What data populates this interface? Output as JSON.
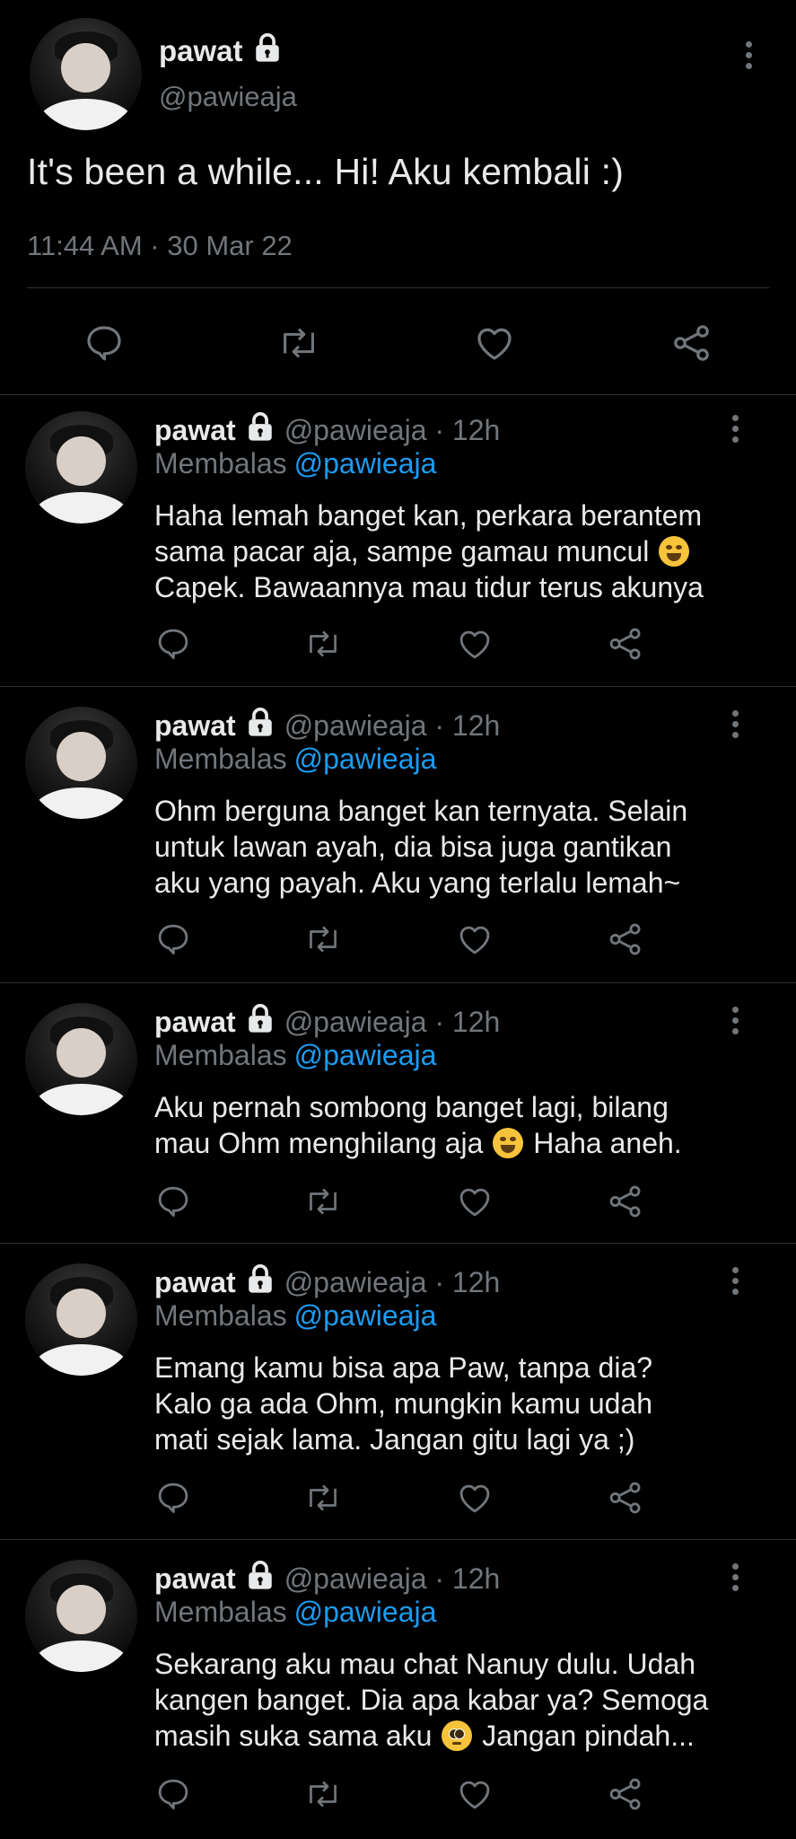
{
  "main_tweet": {
    "name": "pawat",
    "handle": "@pawieaja",
    "text": "It's been a while... Hi! Aku kembali :)",
    "timestamp": "11:44 AM · 30 Mar 22"
  },
  "replies": [
    {
      "name": "pawat",
      "meta": "@pawieaja · 12h",
      "replying_label": "Membalas",
      "replying_to": "@pawieaja",
      "lines": [
        "Haha lemah banget kan, perkara berantem",
        "sama pacar aja, sampe gamau muncul",
        "Capek. Bawaannya mau tidur terus akunya"
      ]
    },
    {
      "name": "pawat",
      "meta": "@pawieaja · 12h",
      "replying_label": "Membalas",
      "replying_to": "@pawieaja",
      "lines": [
        "Ohm berguna banget kan ternyata. Selain",
        "untuk lawan ayah, dia bisa juga gantikan",
        "aku yang payah. Aku yang terlalu lemah~"
      ]
    },
    {
      "name": "pawat",
      "meta": "@pawieaja · 12h",
      "replying_label": "Membalas",
      "replying_to": "@pawieaja",
      "lines": [
        "Aku pernah sombong banget lagi, bilang",
        "mau Ohm menghilang aja",
        "Haha aneh."
      ]
    },
    {
      "name": "pawat",
      "meta": "@pawieaja · 12h",
      "replying_label": "Membalas",
      "replying_to": "@pawieaja",
      "lines": [
        "Emang kamu bisa apa Paw, tanpa dia?",
        "Kalo ga ada Ohm, mungkin kamu udah",
        "mati sejak lama. Jangan gitu lagi ya ;)"
      ]
    },
    {
      "name": "pawat",
      "meta": "@pawieaja · 12h",
      "replying_label": "Membalas",
      "replying_to": "@pawieaja",
      "lines": [
        "Sekarang aku mau chat Nanuy dulu. Udah",
        "kangen banget. Dia apa kabar ya? Semoga",
        "masih suka sama aku",
        "Jangan pindah..."
      ]
    }
  ],
  "colors": {
    "background": "#000000",
    "text_primary": "#e7e9ea",
    "text_secondary": "#71767b",
    "accent": "#1d9bf0",
    "divider": "#2f3336"
  },
  "icons": {
    "lock": "lock-icon",
    "more": "more-vertical-icon",
    "reply": "reply-icon",
    "retweet": "retweet-icon",
    "like": "like-icon",
    "share": "share-icon",
    "laugh_emoji": "face-with-tears-of-joy-emoji",
    "plead_emoji": "pleading-face-emoji"
  }
}
